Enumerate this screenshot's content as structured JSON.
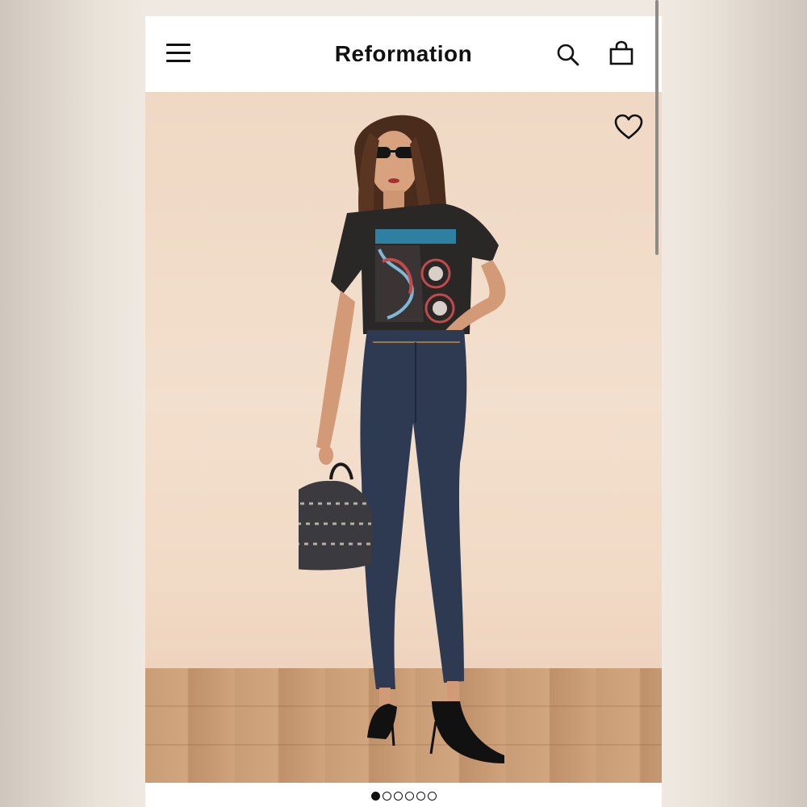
{
  "header": {
    "brand": "Reformation",
    "icons": {
      "menu": "menu-icon",
      "search": "search-icon",
      "bag": "shopping-bag-icon"
    }
  },
  "product_gallery": {
    "favorite_icon": "heart-icon",
    "image_alt": "",
    "pagination": {
      "total": 6,
      "active_index": 0
    }
  },
  "colors": {
    "text": "#111111",
    "background": "#ffffff",
    "studio_wall": "#f1dac6",
    "floor": "#c99d76"
  }
}
